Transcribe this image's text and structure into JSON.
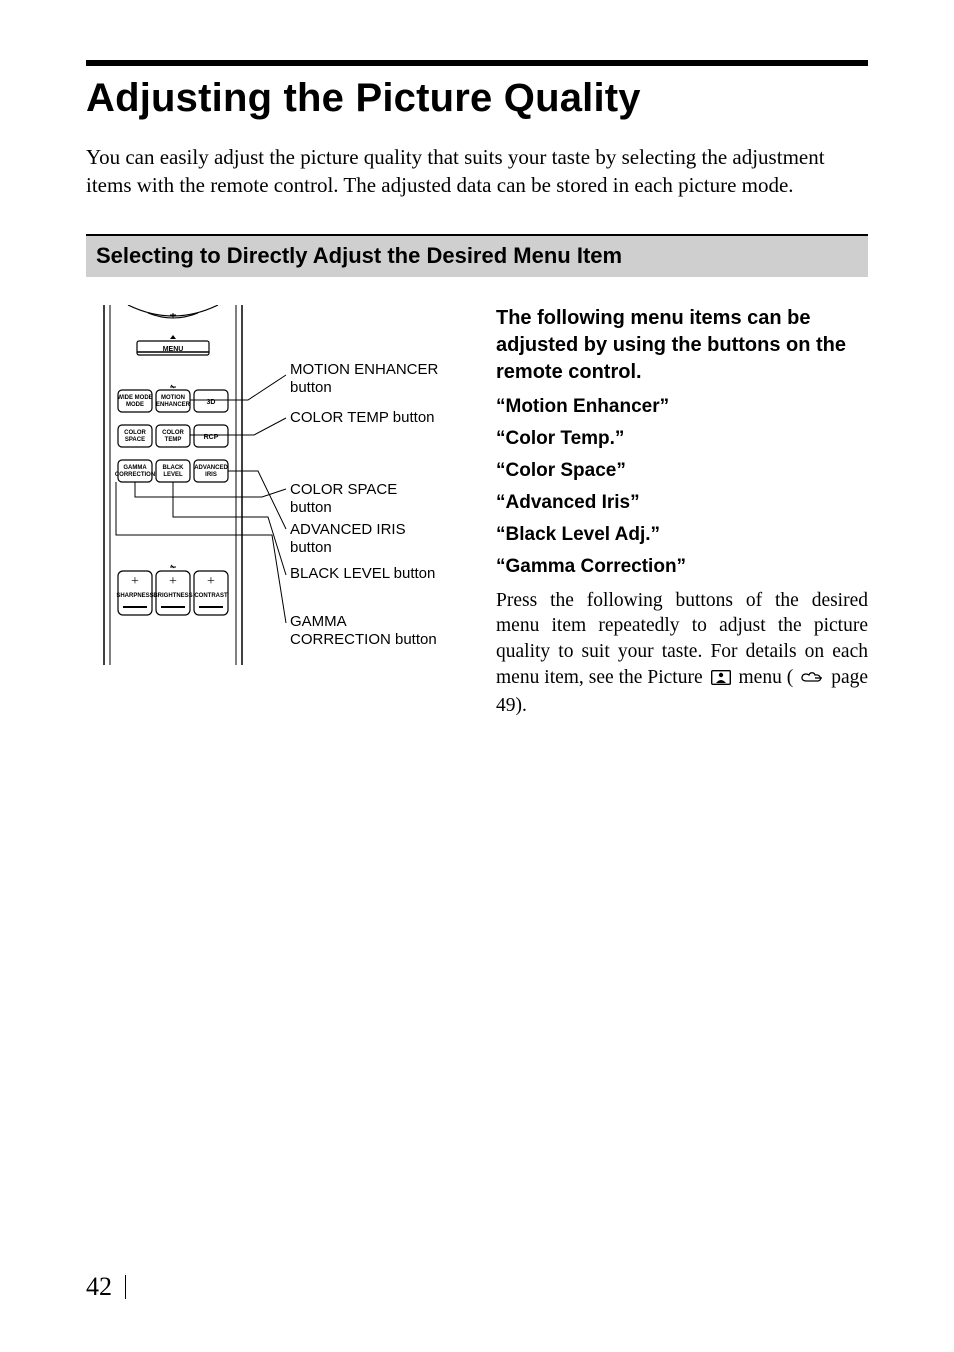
{
  "page_number": "42",
  "title": "Adjusting the Picture Quality",
  "intro": "You can easily adjust the picture quality that suits your taste by selecting the adjustment items with the remote control. The adjusted data can be stored in each picture mode.",
  "subheading": "Selecting to Directly Adjust the Desired Menu Item",
  "right": {
    "lead": "The following menu items can be adjusted by using the buttons on the remote control.",
    "items": [
      "“Motion Enhancer”",
      "“Color Temp.”",
      "“Color Space”",
      "“Advanced Iris”",
      "“Black Level Adj.”",
      "“Gamma Correction”"
    ],
    "para_pre": "Press the following buttons of the desired menu item repeatedly to adjust the picture quality to suit your taste. For details on each menu item, see the Picture ",
    "para_mid": " menu (",
    "para_post": " page 49)."
  },
  "callouts": {
    "motion": "MOTION ENHANCER button",
    "colortemp": "COLOR TEMP button",
    "colorspace": "COLOR SPACE button",
    "adviris": "ADVANCED IRIS button",
    "blacklevel": "BLACK LEVEL button",
    "gamma": "GAMMA CORRECTION button"
  },
  "remote_labels": {
    "menu": "MENU",
    "wide": "WIDE MODE",
    "motion": "MOTION ENHANCER",
    "threeD": "3D",
    "cspace": "COLOR SPACE",
    "ctemp": "COLOR TEMP",
    "rcp": "RCP",
    "gamma": "GAMMA CORRECTION",
    "black": "BLACK LEVEL",
    "iris": "ADVANCED IRIS",
    "sharp": "SHARPNESS",
    "bright": "BRIGHTNESS",
    "contrast": "CONTRAST"
  }
}
